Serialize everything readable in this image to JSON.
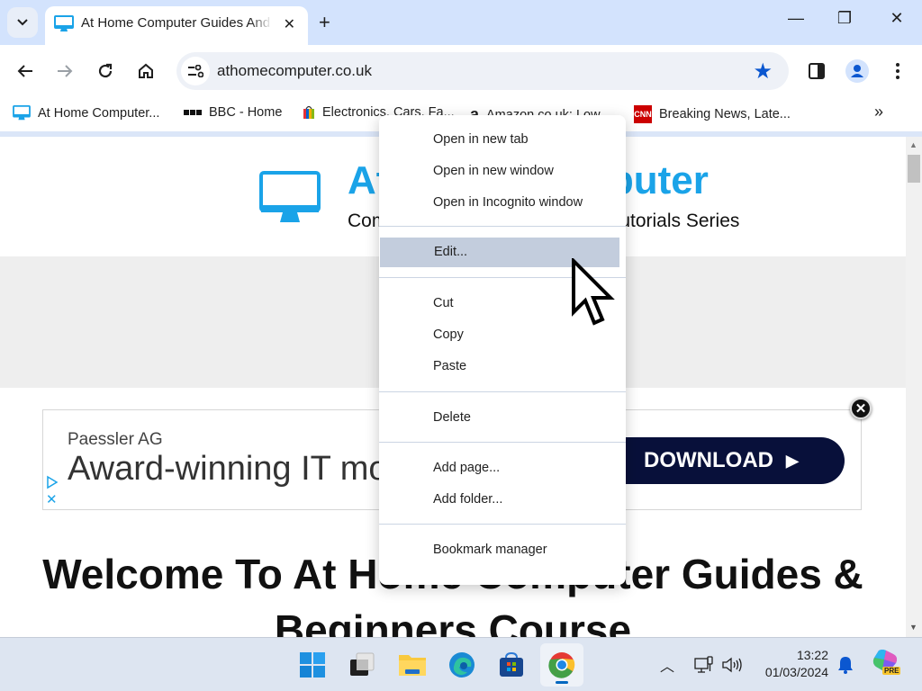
{
  "browser": {
    "tab": {
      "title": "At Home Computer Guides And Beginners Course",
      "favicon": "monitor-icon"
    },
    "new_tab_label": "+",
    "window_controls": {
      "minimize": "—",
      "restore": "❐",
      "close": "✕"
    },
    "url": "athomecomputer.co.uk",
    "bookmark_starred": true,
    "accent_color": "#0b57d0"
  },
  "bookmarks": [
    {
      "label": "At Home Computer...",
      "icon": "monitor-icon"
    },
    {
      "label": "BBC - Home",
      "icon": "bbc-icon"
    },
    {
      "label": "Electronics, Cars, Fa...",
      "icon": "shopping-bag-icon"
    },
    {
      "label": "Amazon.co.uk: Low...",
      "icon": "amazon-icon"
    },
    {
      "label": "Breaking News, Late...",
      "icon": "cnn-icon"
    }
  ],
  "bookmarks_overflow": "»",
  "context_menu": {
    "items": [
      {
        "label": "Open in new tab"
      },
      {
        "label": "Open in new window"
      },
      {
        "label": "Open in Incognito window"
      },
      {
        "label": "Edit...",
        "highlighted": true
      },
      {
        "label": "Cut"
      },
      {
        "label": "Copy"
      },
      {
        "label": "Paste"
      },
      {
        "label": "Delete"
      },
      {
        "label": "Add page..."
      },
      {
        "label": "Add folder..."
      },
      {
        "label": "Bookmark manager"
      }
    ]
  },
  "page": {
    "site_title": "At Home Computer",
    "tagline": "Computer Guides & Beginners Tutorials Series",
    "brand_color": "#1aa3e8",
    "ad": {
      "advertiser": "Paessler AG",
      "headline": "Award-winning IT monitoring",
      "cta": "DOWNLOAD",
      "close": "✕"
    },
    "heading": "Welcome To At Home Computer Guides & Beginners Course"
  },
  "taskbar": {
    "apps": [
      "start",
      "task-view",
      "file-explorer",
      "edge",
      "microsoft-store",
      "chrome"
    ],
    "active_app": "chrome",
    "time": "13:22",
    "date": "01/03/2024",
    "copilot_badge": "PRE"
  }
}
